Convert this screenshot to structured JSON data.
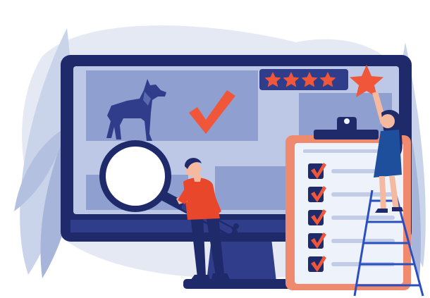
{
  "colors": {
    "background_blob": "#e4e9f4",
    "leaf_light": "#c9d3ea",
    "leaf_mid": "#a7b5da",
    "monitor_frame": "#1f2a6b",
    "monitor_frame_inner": "#2f3d8a",
    "screen": "#bdc7e6",
    "panel": "#8f9fcf",
    "dog": "#2f3d8a",
    "accent": "#f0563a",
    "clipboard_frame": "#f08a6e",
    "clipboard_paper": "#eef2fb",
    "clipboard_line": "#c3cce6",
    "man_shirt": "#e8472b",
    "man_pants": "#1f2a6b",
    "woman_dress": "#1e4f9c",
    "hair": "#1f2a6b",
    "skin": "#f5b9a0",
    "ladder": "#2a4fbf"
  },
  "icons": {
    "rating": "star-icon",
    "check": "checkmark-icon",
    "search": "magnifying-glass-icon",
    "pet": "dog-icon",
    "document": "clipboard-icon"
  },
  "rating": {
    "filled_stars": 5,
    "max_stars": 5
  },
  "checklist": {
    "checked_items": 5,
    "total_items": 5
  }
}
